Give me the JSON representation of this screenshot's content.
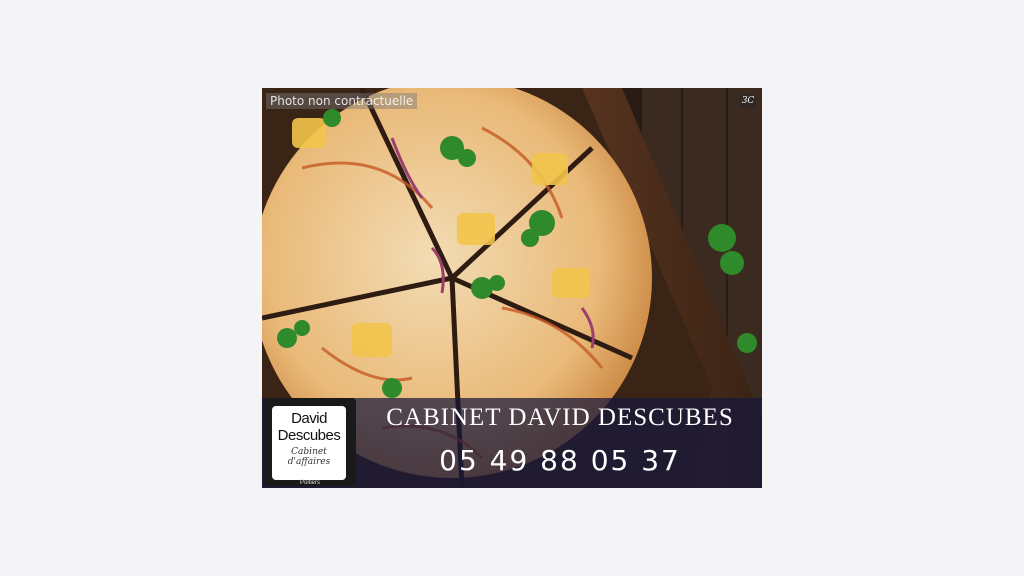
{
  "photo": {
    "disclaimer": "Photo non contractuelle",
    "corner_icon": "zoom-icon",
    "corner_icon_glyph": "3C"
  },
  "banner": {
    "firm_name": "CABINET DAVID DESCUBES",
    "phone": "05 49 88 05 37"
  },
  "logo": {
    "line1": "David",
    "line2": "Descubes",
    "sub1": "Cabinet",
    "sub2": "d'affaires",
    "city": "Poitiers"
  },
  "colors": {
    "page_bg": "#f4f4f6",
    "banner_bg": "#16183c"
  }
}
